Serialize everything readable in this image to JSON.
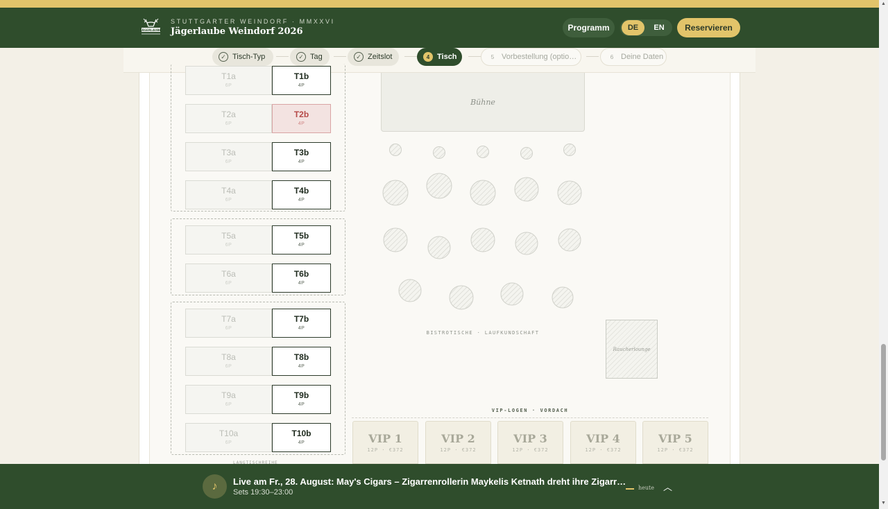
{
  "header": {
    "brand_small": "STUTTGARTER WEINDORF · MMXXVI",
    "brand_title": "Jägerlaube Weindorf 2026",
    "logo_text": "JÄGERLAUBE",
    "programm_label": "Programm",
    "lang_de": "DE",
    "lang_en": "EN",
    "reserve_label": "Reservieren"
  },
  "steps": [
    {
      "label": "Tisch-Typ",
      "state": "done"
    },
    {
      "label": "Tag",
      "state": "done"
    },
    {
      "label": "Zeitslot",
      "state": "done"
    },
    {
      "number": "4",
      "label": "Tisch",
      "state": "active"
    },
    {
      "number": "5",
      "label": "Vorbestellung (optio…",
      "state": "todo"
    },
    {
      "number": "6",
      "label": "Deine Daten",
      "state": "todo"
    }
  ],
  "tables": [
    {
      "a": "T1a",
      "a_cap": "6P",
      "b": "T1b",
      "b_cap": "4P"
    },
    {
      "a": "T2a",
      "a_cap": "6P",
      "b": "T2b",
      "b_cap": "4P",
      "b_taken": true
    },
    {
      "a": "T3a",
      "a_cap": "6P",
      "b": "T3b",
      "b_cap": "4P"
    },
    {
      "a": "T4a",
      "a_cap": "6P",
      "b": "T4b",
      "b_cap": "4P"
    },
    {
      "a": "T5a",
      "a_cap": "6P",
      "b": "T5b",
      "b_cap": "4P"
    },
    {
      "a": "T6a",
      "a_cap": "6P",
      "b": "T6b",
      "b_cap": "4P"
    },
    {
      "a": "T7a",
      "a_cap": "6P",
      "b": "T7b",
      "b_cap": "4P"
    },
    {
      "a": "T8a",
      "a_cap": "6P",
      "b": "T8b",
      "b_cap": "4P"
    },
    {
      "a": "T9a",
      "a_cap": "6P",
      "b": "T9b",
      "b_cap": "4P"
    },
    {
      "a": "T10a",
      "a_cap": "6P",
      "b": "T10b",
      "b_cap": "4P"
    }
  ],
  "floor": {
    "stage_label": "Bühne",
    "bistro_label": "BISTROTISCHE · LAUFKUNDSCHAFT",
    "raucher_label": "Raucherlounge",
    "vip_section_label": "VIP-LOGEN · VORDACH",
    "under_label": "LANGTISCHREIHE"
  },
  "vips": [
    {
      "name": "VIP 1",
      "info": "12P · €372"
    },
    {
      "name": "VIP 2",
      "info": "12P · €372"
    },
    {
      "name": "VIP 3",
      "info": "12P · €372"
    },
    {
      "name": "VIP 4",
      "info": "12P · €372"
    },
    {
      "name": "VIP 5",
      "info": "12P · €372"
    }
  ],
  "live_bar": {
    "title": "Live am Fr., 28. August: May's Cigars – Zigarrenrollerin Maykelis Ketnath dreht ihre Zigarr…",
    "subtitle": "Sets 19:30–23:00",
    "heute_label": "heute",
    "music_icon": "music-note-icon",
    "expand_icon": "chevron-up-icon"
  },
  "colors": {
    "header_green": "#2f4d2c",
    "accent_gold": "#e2c46a",
    "taken_red": "#b64a48"
  }
}
